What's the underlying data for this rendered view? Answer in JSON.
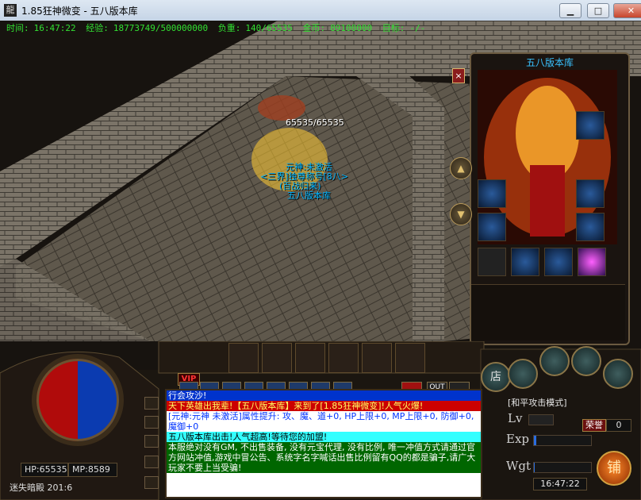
{
  "window": {
    "icon_char": "龍",
    "title": "1.85狂神微变 - 五八版本库",
    "minimize": "▁",
    "maximize": "□",
    "close": "✕"
  },
  "status": {
    "time_label": "时间:",
    "time": "16:47:22",
    "exp_label": "经验:",
    "exp": "18773749/500000000",
    "weight_label": "负重:",
    "weight": "140/65535",
    "gold_label": "金币:",
    "gold": "89100000",
    "target_label": "目标:",
    "target": "-/-"
  },
  "scene": {
    "hp_display": "65535/65535",
    "char_lines": [
      "元神:未激活",
      "<三界]独尊称号[8八>",
      "(百战归来)",
      "五八版本库"
    ]
  },
  "panel": {
    "title": "五八版本库",
    "close": "×",
    "up": "▲",
    "down": "▼"
  },
  "hud": {
    "hp": "HP:65535",
    "mp": "MP:8589",
    "map": "迷失暗殿",
    "coords": "201:6",
    "vip": "VIP",
    "out": "OUT",
    "mode": "[和平攻击模式]",
    "lv": "Lv",
    "exp": "Exp",
    "wgt": "Wgt",
    "rongyu": "荣誉",
    "rongyu_val": "0",
    "clock": "16:47:22",
    "shop": "铺",
    "store": "店"
  },
  "chat": [
    {
      "text": "行会攻沙!",
      "color": "#ffffff",
      "bg": "#0033cc"
    },
    {
      "text": "天下英雄出我辈!【五八版本库】来到了[1.85狂神微变]!人气火爆!",
      "color": "#ffff66",
      "bg": "#cc0000"
    },
    {
      "text": "[元神:元神 未激活]属性提升: 攻、魔、道+0, HP上限+0, MP上限+0, 防御+0, 魔御+0",
      "color": "#0033ff",
      "bg": "#ffffff"
    },
    {
      "text": "五八版本库出击!人气超高!等待您的加盟!",
      "color": "#000000",
      "bg": "#33ffff"
    },
    {
      "text": "本服绝对没有GM, 不出售装备, 没有元宝代理, 没有比例, 唯一冲值方式请通过官方网站冲值,游戏中冒公告、系统字名字喊话出售比例留有QQ的都是骗子,请广大玩家不要上当受骗!",
      "color": "#ffffff",
      "bg": "#006600"
    }
  ],
  "colors": {
    "status_green": "#32e032",
    "name_blue": "#00b4ff",
    "hp_red": "#b00b0b",
    "mp_blue": "#0b3bb0"
  }
}
